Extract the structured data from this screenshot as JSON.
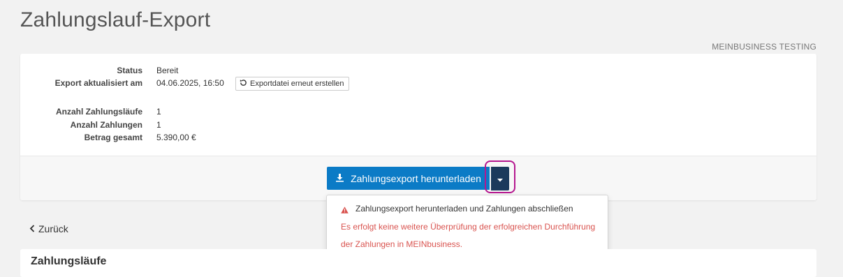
{
  "page": {
    "title": "Zahlungslauf-Export",
    "company": "MEINBUSINESS TESTING"
  },
  "details": {
    "status_label": "Status",
    "status_value": "Bereit",
    "updated_label": "Export aktualisiert am",
    "updated_value": "04.06.2025, 16:50",
    "regenerate_label": "Exportdatei erneut erstellen",
    "runs_label": "Anzahl Zahlungsläufe",
    "runs_value": "1",
    "payments_label": "Anzahl Zahlungen",
    "payments_value": "1",
    "total_label": "Betrag gesamt",
    "total_value": "5.390,00 €"
  },
  "actions": {
    "download_label": "Zahlungsexport herunterladen",
    "menu_item_label": "Zahlungsexport herunterladen und Zahlungen abschließen",
    "menu_note_line1": "Es erfolgt keine weitere Überprüfung der erfolgreichen Durchführung",
    "menu_note_line2": "der Zahlungen in MEINbusiness."
  },
  "nav": {
    "back_label": "Zurück"
  },
  "section": {
    "title": "Zahlungsläufe"
  },
  "icons": {
    "download": "download-icon",
    "caret": "caret-down-icon",
    "refresh": "refresh-icon",
    "warning": "warning-icon",
    "back": "chevron-left-icon"
  },
  "colors": {
    "primary": "#0b7bc6",
    "dropdown_toggle": "#1c3a5c",
    "highlight": "#b5178f",
    "warning": "#d9534f"
  }
}
